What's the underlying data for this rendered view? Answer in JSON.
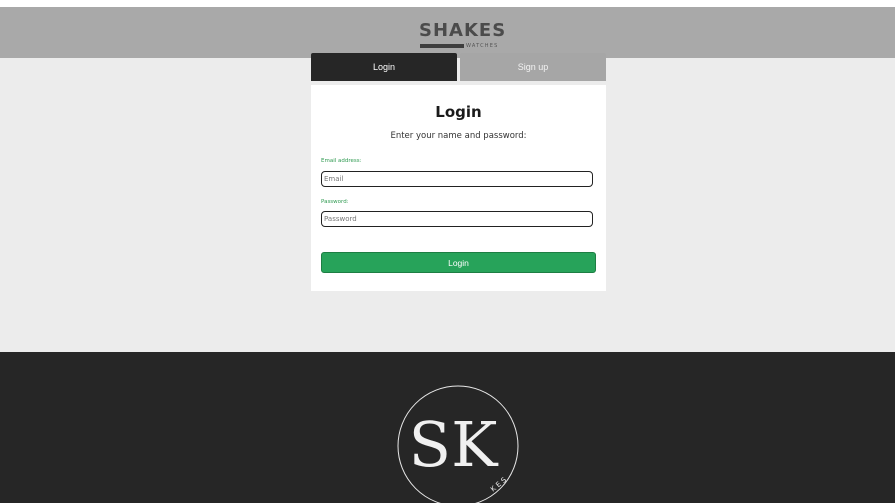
{
  "header": {
    "brand": "SHAKES",
    "brand_sub": "WATCHES"
  },
  "tabs": [
    {
      "label": "Login",
      "active": true
    },
    {
      "label": "Sign up",
      "active": false
    }
  ],
  "login_form": {
    "title": "Login",
    "subtitle": "Enter your name and password:",
    "email_label": "Email address:",
    "email_placeholder": "Email",
    "email_value": "",
    "password_label": "Password:",
    "password_placeholder": "Password",
    "password_value": "",
    "submit_label": "Login"
  },
  "footer": {
    "logo_monogram": "SK",
    "logo_ring_text": "K E S"
  },
  "colors": {
    "header_bg": "#a9a9a9",
    "page_bg": "#ececec",
    "tab_active": "#262626",
    "tab_inactive": "#a6a6a6",
    "accent_green": "#27a35a",
    "label_green": "#2f9a51",
    "footer_bg": "#262626"
  }
}
